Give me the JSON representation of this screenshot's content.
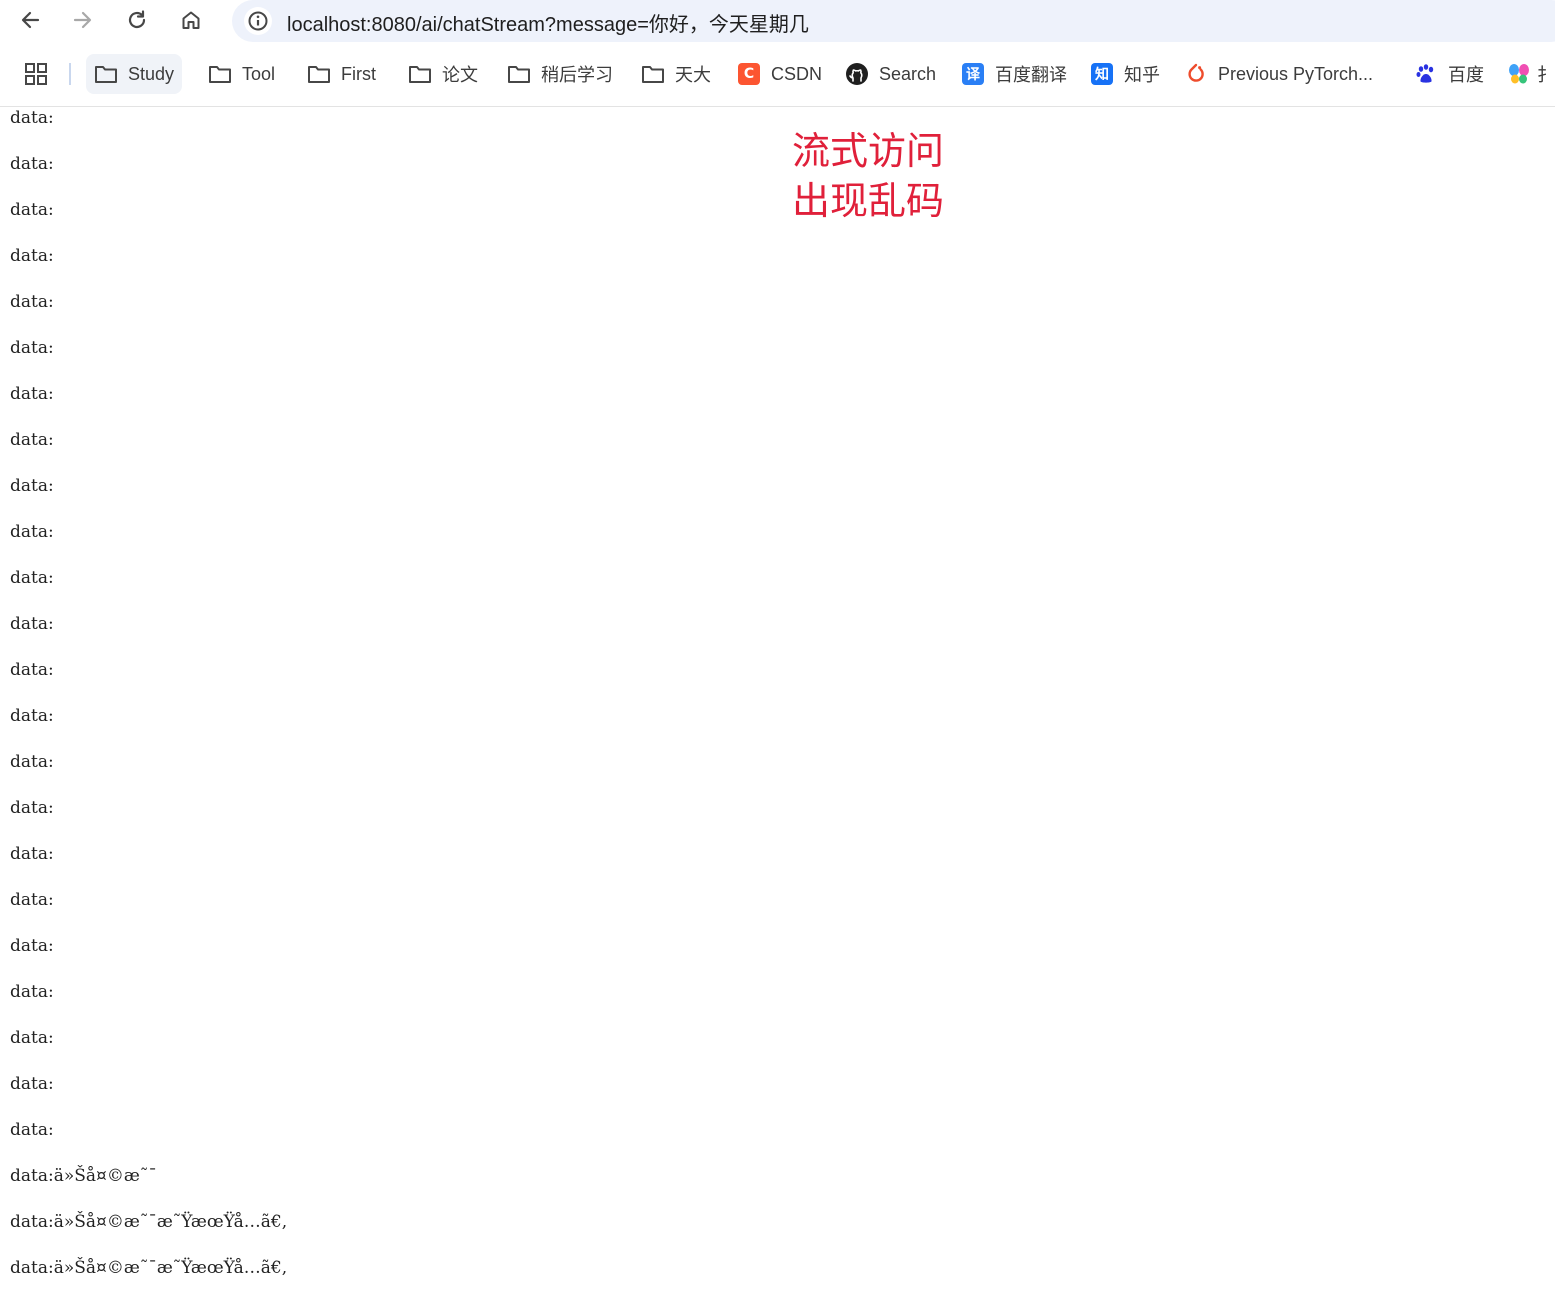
{
  "browser": {
    "url": "localhost:8080/ai/chatStream?message=你好，今天星期几",
    "nav_icons": [
      "back-arrow-icon",
      "forward-arrow-icon",
      "reload-icon",
      "home-icon",
      "site-info-icon"
    ]
  },
  "bookmarks": {
    "apps_icon": "apps-grid-icon",
    "items": [
      {
        "label": "Study",
        "icon": "folder-icon"
      },
      {
        "label": "Tool",
        "icon": "folder-icon"
      },
      {
        "label": "First",
        "icon": "folder-icon"
      },
      {
        "label": "论文",
        "icon": "folder-icon"
      },
      {
        "label": "稍后学习",
        "icon": "folder-icon"
      },
      {
        "label": "天大",
        "icon": "folder-icon"
      },
      {
        "label": "CSDN",
        "icon": "csdn-icon",
        "color": "#fc5531"
      },
      {
        "label": "Search",
        "icon": "github-icon"
      },
      {
        "label": "百度翻译",
        "icon": "baidu-translate-icon",
        "color": "#2a7ff5"
      },
      {
        "label": "知乎",
        "icon": "zhihu-icon",
        "color": "#1772f6"
      },
      {
        "label": "Previous PyTorch...",
        "icon": "pytorch-icon",
        "color": "#ee4c2c"
      },
      {
        "label": "百度",
        "icon": "baidu-paw-icon",
        "color": "#2932e1"
      },
      {
        "label": "扌",
        "icon": "butterfly-icon"
      }
    ]
  },
  "stream": {
    "lines": [
      "data:",
      "data:",
      "data:",
      "data:",
      "data:",
      "data:",
      "data:",
      "data:",
      "data:",
      "data:",
      "data:",
      "data:",
      "data:",
      "data:",
      "data:",
      "data:",
      "data:",
      "data:",
      "data:",
      "data:",
      "data:",
      "data:",
      "data:",
      "data:ä»Šå¤©æ˜¯",
      "data:ä»Šå¤©æ˜¯æ˜ŸæœŸå…­ã€‚",
      "data:ä»Šå¤©æ˜¯æ˜ŸæœŸå…­ã€‚"
    ]
  },
  "annotation": {
    "line1": "流式访问",
    "line2": "出现乱码",
    "color": "#e0203a"
  }
}
